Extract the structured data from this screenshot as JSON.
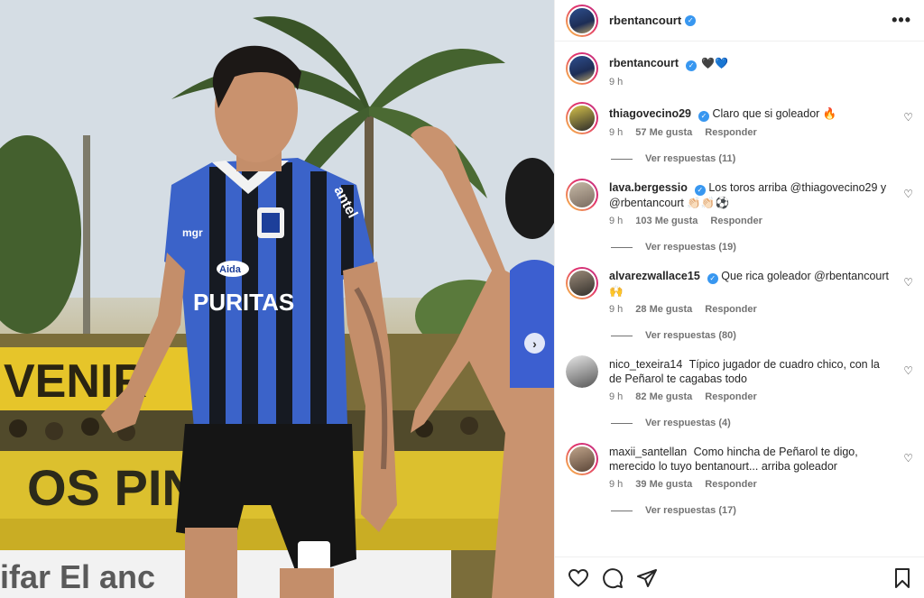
{
  "post": {
    "author": "rbentancourt",
    "caption_emoji": "🖤💙",
    "caption_time": "9 h"
  },
  "photo": {
    "jersey_sponsor": "PURITAS",
    "jersey_sponsor2": "Aida",
    "kit_brand": "mgr",
    "sleeve_text": "antel",
    "banner_left": "VENIR",
    "banner_mid": "OS PIN",
    "board_text": "ifar  El  anc",
    "next_icon": "chevron-right-icon"
  },
  "comments": [
    {
      "user": "thiagovecino29",
      "text": "Claro que si goleador 🔥",
      "time": "9 h",
      "likes": "57 Me gusta",
      "reply": "Responder",
      "view_replies": "Ver respuestas (11)"
    },
    {
      "user": "lava.bergessio",
      "text": "Los toros arriba @thiagovecino29 y @rbentancourt 👏🏻👏🏻⚽",
      "time": "9 h",
      "likes": "103 Me gusta",
      "reply": "Responder",
      "view_replies": "Ver respuestas (19)"
    },
    {
      "user": "alvarezwallace15",
      "text": "Que rica goleador @rbentancourt 🙌",
      "time": "9 h",
      "likes": "28 Me gusta",
      "reply": "Responder",
      "view_replies": "Ver respuestas (80)"
    },
    {
      "user": "nico_texeira14",
      "text": "Típico jugador de cuadro chico, con la de Peñarol te cagabas todo",
      "time": "9 h",
      "likes": "82 Me gusta",
      "reply": "Responder",
      "view_replies": "Ver respuestas (4)"
    },
    {
      "user": "maxii_santellan",
      "text": "Como hincha de Peñarol te digo, merecido lo tuyo bentanourt... arriba goleador",
      "time": "9 h",
      "likes": "39 Me gusta",
      "reply": "Responder",
      "view_replies": "Ver respuestas (17)"
    }
  ],
  "icons": {
    "verified": "✓",
    "more": "•••",
    "heart": "♡"
  },
  "colors": {
    "verified_blue": "#3897f0",
    "jersey_blue": "#3b63c9",
    "jersey_black": "#161a22",
    "banner_yellow": "#e6c52a"
  }
}
